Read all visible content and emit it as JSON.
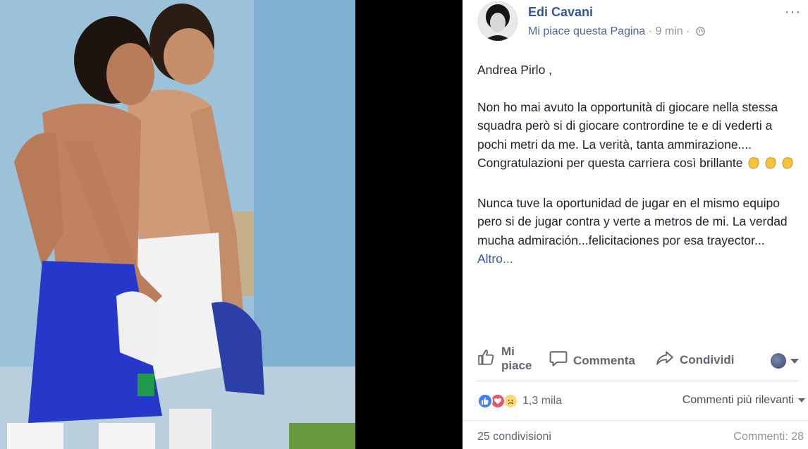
{
  "post": {
    "author": "Edi Cavani",
    "page_like": "Mi piace questa Pagina",
    "separator": "·",
    "time": "9 min",
    "time_separator": "·",
    "more_menu": "···",
    "greeting": "Andrea Pirlo ,",
    "paragraph_it": "Non ho mai avuto la opportunità di giocare nella stessa squadra però si di giocare contrordine te e di vederti a pochi metri da me. La verità, tanta ammirazione.... Congratulazioni per questa carriera così brillante",
    "paragraph_es": "Nunca tuve la oportunidad de jugar en el mismo equipo pero si de jugar contra y verte a metros de mi. La verdad mucha admiración...felicitaciones por esa trayector...",
    "see_more": "Altro..."
  },
  "actions": {
    "like_line1": "Mi",
    "like_line2": "piace",
    "comment": "Commenta",
    "share": "Condividi"
  },
  "reactions": {
    "count": "1,3 mila",
    "sort_label": "Commenti più rilevanti"
  },
  "footer": {
    "shares": "25 condivisioni",
    "comments": "Commenti: 28"
  },
  "colors": {
    "link_blue": "#365899",
    "text": "#1d2129",
    "muted": "#90949c",
    "like_blue": "#4080ff",
    "love_red": "#f25268",
    "sad_yellow": "#ffd972"
  },
  "icons": [
    "globe-icon",
    "clap-emoji",
    "like-thumb-icon",
    "comment-bubble-icon",
    "share-arrow-icon",
    "more-dots-icon",
    "caret-down-icon"
  ]
}
